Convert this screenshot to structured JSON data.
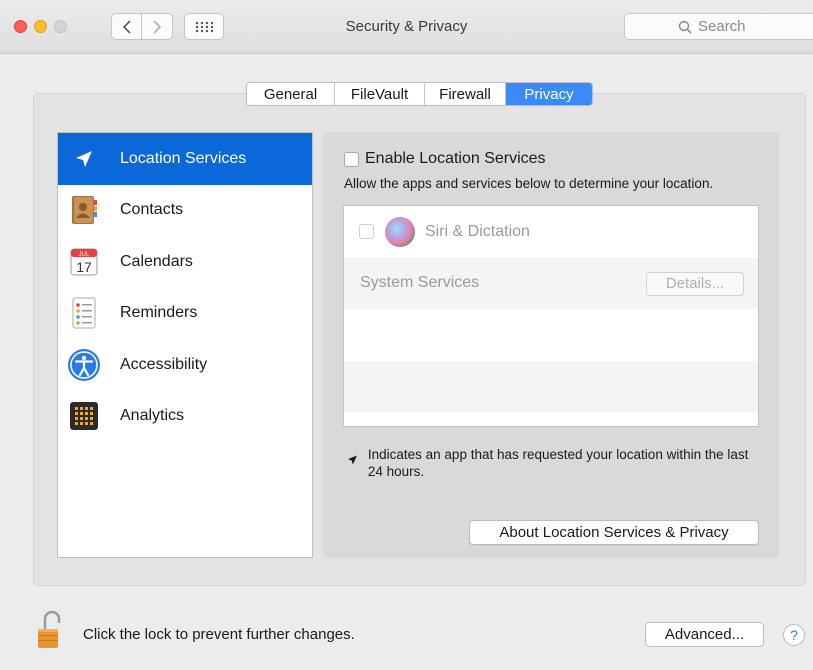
{
  "window": {
    "title": "Security & Privacy",
    "search_placeholder": "Search"
  },
  "tabs": [
    {
      "label": "General",
      "selected": false
    },
    {
      "label": "FileVault",
      "selected": false
    },
    {
      "label": "Firewall",
      "selected": false
    },
    {
      "label": "Privacy",
      "selected": true
    }
  ],
  "sidebar": {
    "items": [
      {
        "label": "Location Services",
        "icon": "location-arrow-icon",
        "selected": true
      },
      {
        "label": "Contacts",
        "icon": "contacts-book-icon"
      },
      {
        "label": "Calendars",
        "icon": "calendar-icon",
        "cal_month": "JUL",
        "cal_day": "17"
      },
      {
        "label": "Reminders",
        "icon": "reminders-icon"
      },
      {
        "label": "Accessibility",
        "icon": "accessibility-icon"
      },
      {
        "label": "Analytics",
        "icon": "analytics-icon"
      }
    ]
  },
  "location": {
    "enable_label": "Enable Location Services",
    "enabled": false,
    "description": "Allow the apps and services below to determine your location.",
    "apps": [
      {
        "label": "Siri & Dictation",
        "checked": false
      }
    ],
    "system_services_label": "System Services",
    "details_label": "Details...",
    "indicator_text": "Indicates an app that has requested your location within the last 24 hours.",
    "about_label": "About Location Services & Privacy"
  },
  "footer": {
    "lock_text": "Click the lock to prevent further changes.",
    "advanced_label": "Advanced...",
    "help_label": "?"
  },
  "colors": {
    "accent": "#0a68d8",
    "tab_selected": "#3a8bf5",
    "close": "#fc5f57",
    "minimize": "#fdbc2e"
  }
}
